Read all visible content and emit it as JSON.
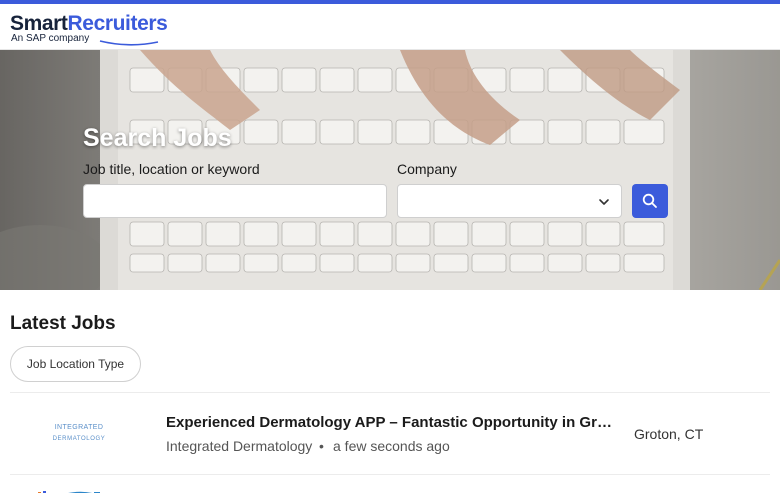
{
  "colors": {
    "brand_blue": "#3b5bdb",
    "brand_navy": "#17233b"
  },
  "header": {
    "logo_part1": "Smart",
    "logo_part2": "Recruiters",
    "logo_tagline": "An SAP company"
  },
  "hero": {
    "title": "Search Jobs",
    "keyword_label": "Job title, location or keyword",
    "keyword_value": "",
    "company_label": "Company",
    "company_value": "",
    "search_icon": "search-icon",
    "dropdown_icon": "chevron-down-icon"
  },
  "latest": {
    "title": "Latest Jobs",
    "filter_label": "Job Location Type"
  },
  "jobs": [
    {
      "logo_line1": "INTEGRATED",
      "logo_line2": "DERMATOLOGY",
      "title": "Experienced Dermatology APP – Fantastic Opportunity in Groton, CT",
      "company": "Integrated Dermatology",
      "separator": "•",
      "posted": "a few seconds ago",
      "location": "Groton, CT"
    }
  ]
}
